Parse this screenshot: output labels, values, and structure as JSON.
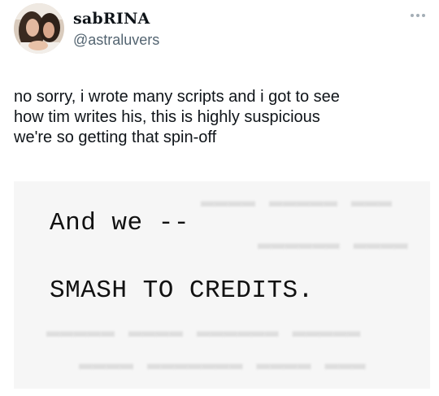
{
  "author": {
    "display_name": "sabRINA",
    "handle": "@astraluvers",
    "avatar_icon": "profile-photo"
  },
  "menu": {
    "more_icon": "more-horizontal-icon"
  },
  "tweet": {
    "text_lines": [
      "no sorry, i wrote many scripts and i got to see",
      "how tim writes his, this is highly suspicious",
      "we're so getting that spin-off"
    ]
  },
  "media": {
    "script_lines": [
      "And we --",
      "SMASH TO CREDITS."
    ]
  },
  "colors": {
    "text_primary": "#0f1419",
    "text_secondary": "#536471",
    "media_background": "#f6f6f6"
  }
}
